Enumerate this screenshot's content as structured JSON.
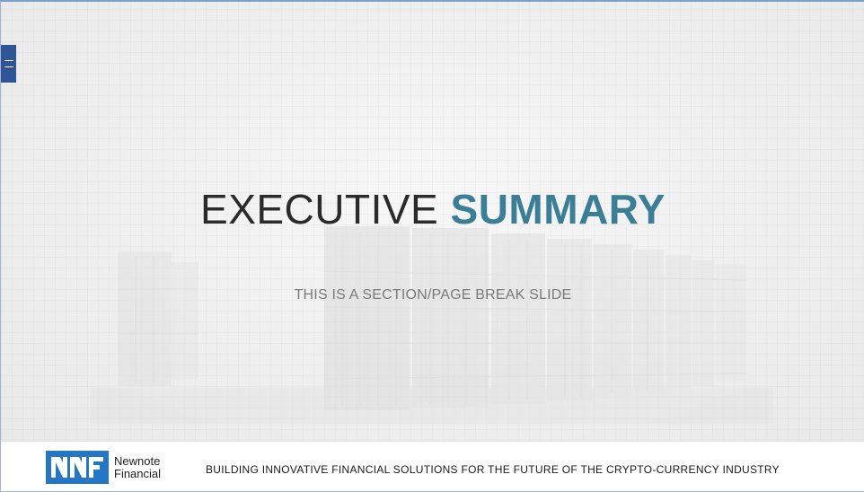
{
  "slide": {
    "title_part1": "EXECUTIVE",
    "title_part2": "SUMMARY",
    "subtitle": "THIS IS A SECTION/PAGE BREAK SLIDE"
  },
  "menu": {
    "icon": "hamburger-icon"
  },
  "footer": {
    "logo_line1": "Newnote",
    "logo_line2": "Financial",
    "tagline": "BUILDING INNOVATIVE  FINANCIAL  SOLUTIONS FOR THE  FUTURE  OF THE  CRYPTO-CURRENCY  INDUSTRY"
  },
  "colors": {
    "accent": "#3a7f96",
    "menu_tab": "#2f5597",
    "logo_blue": "#2576c4",
    "title_dark": "#2b2b2b",
    "subtitle_gray": "#7a7a7a"
  }
}
